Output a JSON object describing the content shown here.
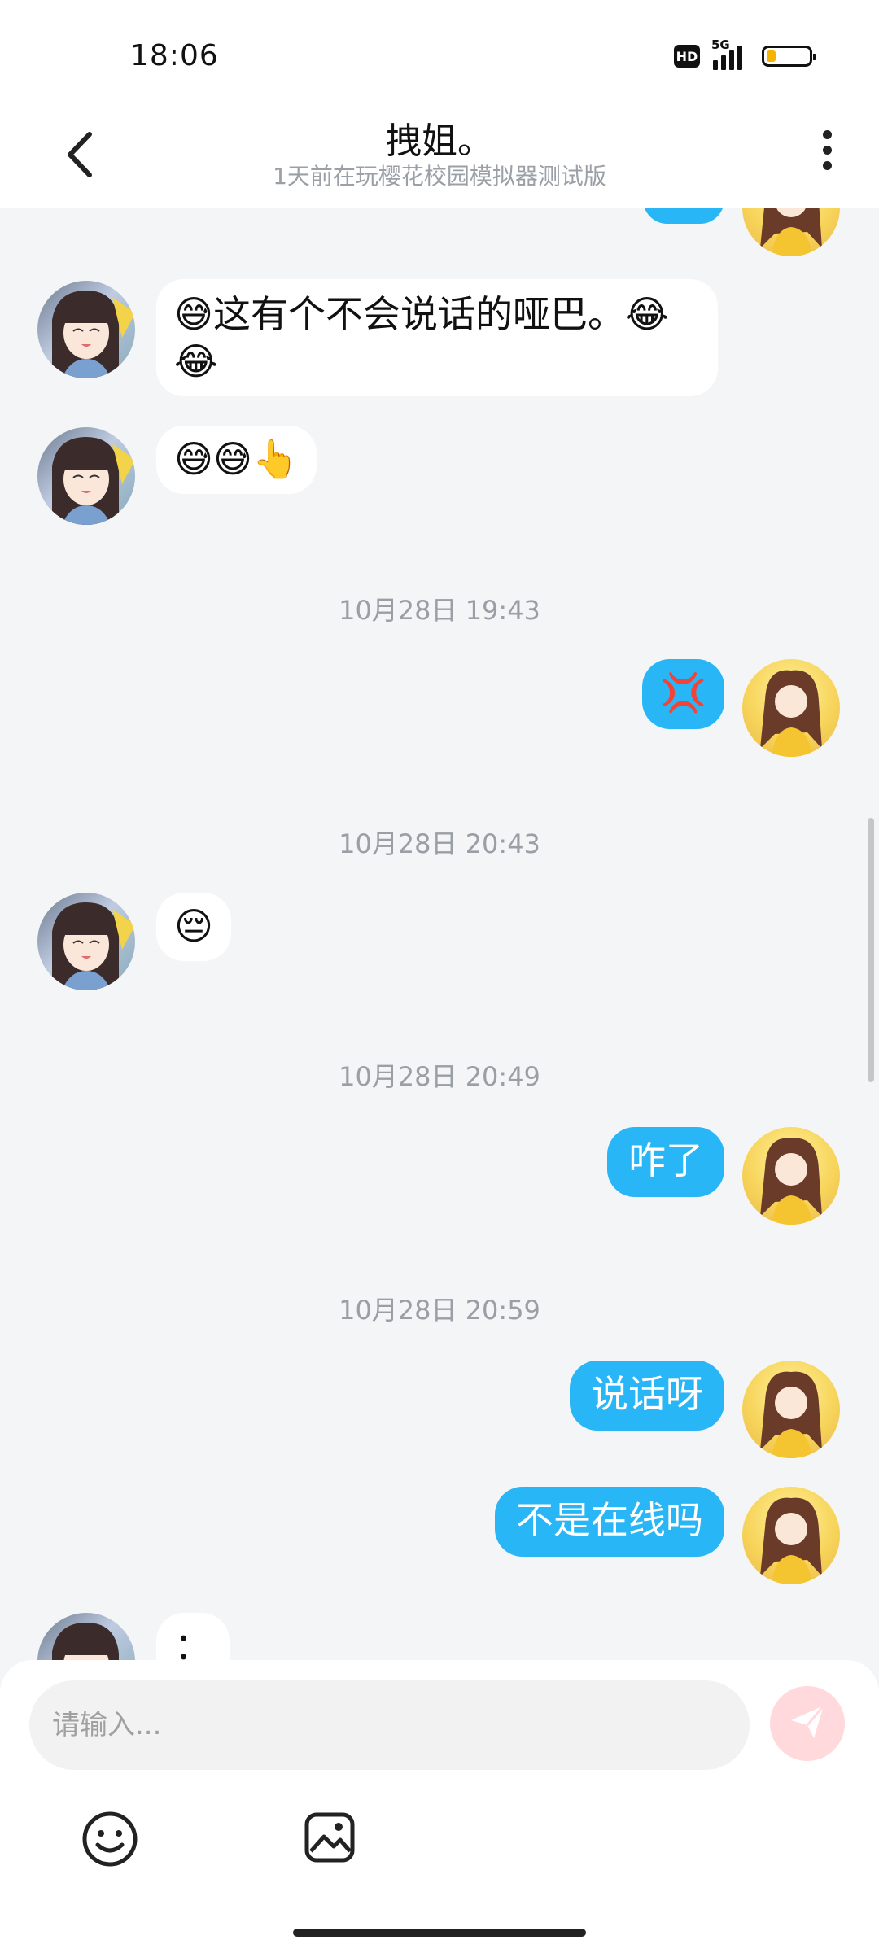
{
  "status_bar": {
    "time": "18:06",
    "hd_label": "HD",
    "network_label": "5G",
    "battery_level": 0.22
  },
  "header": {
    "title": "拽姐。",
    "subtitle": "1天前在玩樱花校园模拟器测试版"
  },
  "chat": {
    "messages": [
      {
        "from": "them",
        "text": "😅这有个不会说话的哑巴。😂"
      },
      {
        "from": "them",
        "text": "😂"
      },
      {
        "from": "them",
        "text": "😅😅👆"
      },
      {
        "timestamp": "10月28日 19:43"
      },
      {
        "from": "me",
        "text": "💢"
      },
      {
        "timestamp": "10月28日 20:43"
      },
      {
        "from": "them",
        "text": "😔"
      },
      {
        "timestamp": "10月28日 20:49"
      },
      {
        "from": "me",
        "text": "咋了"
      },
      {
        "timestamp": "10月28日 20:59"
      },
      {
        "from": "me",
        "text": "说话呀"
      },
      {
        "from": "me",
        "text": "不是在线吗"
      },
      {
        "from": "them",
        "text": "："
      }
    ]
  },
  "composer": {
    "placeholder": "请输入..."
  },
  "icons": {
    "back": "chevron-left-icon",
    "more": "more-vertical-icon",
    "send": "send-icon",
    "emoji": "emoji-icon",
    "image": "image-icon"
  },
  "colors": {
    "outgoing_bubble": "#29b6f6",
    "send_button": "#ffd9dc",
    "send_arrow": "#ffffff"
  }
}
